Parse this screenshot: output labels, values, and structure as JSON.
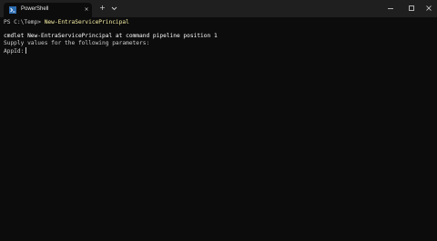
{
  "tab": {
    "title": "PowerShell",
    "icon": "powershell-icon"
  },
  "titlebar": {
    "new_tab": "+",
    "close_tab": "×",
    "dropdown_icon": "chevron-down-icon",
    "minimize_icon": "minimize-icon",
    "maximize_icon": "maximize-icon",
    "close_icon": "close-icon"
  },
  "terminal": {
    "prompt": "PS C:\\Temp> ",
    "command": "New-EntraServicePrincipal",
    "line2": "cmdlet New-EntraServicePrincipal at command pipeline position 1",
    "line3": "Supply values for the following parameters:",
    "line4_label": "AppId:"
  },
  "colors": {
    "background": "#0c0c0c",
    "titlebar": "#1f1f1f",
    "command": "#f9f1a5",
    "text": "#cccccc"
  }
}
